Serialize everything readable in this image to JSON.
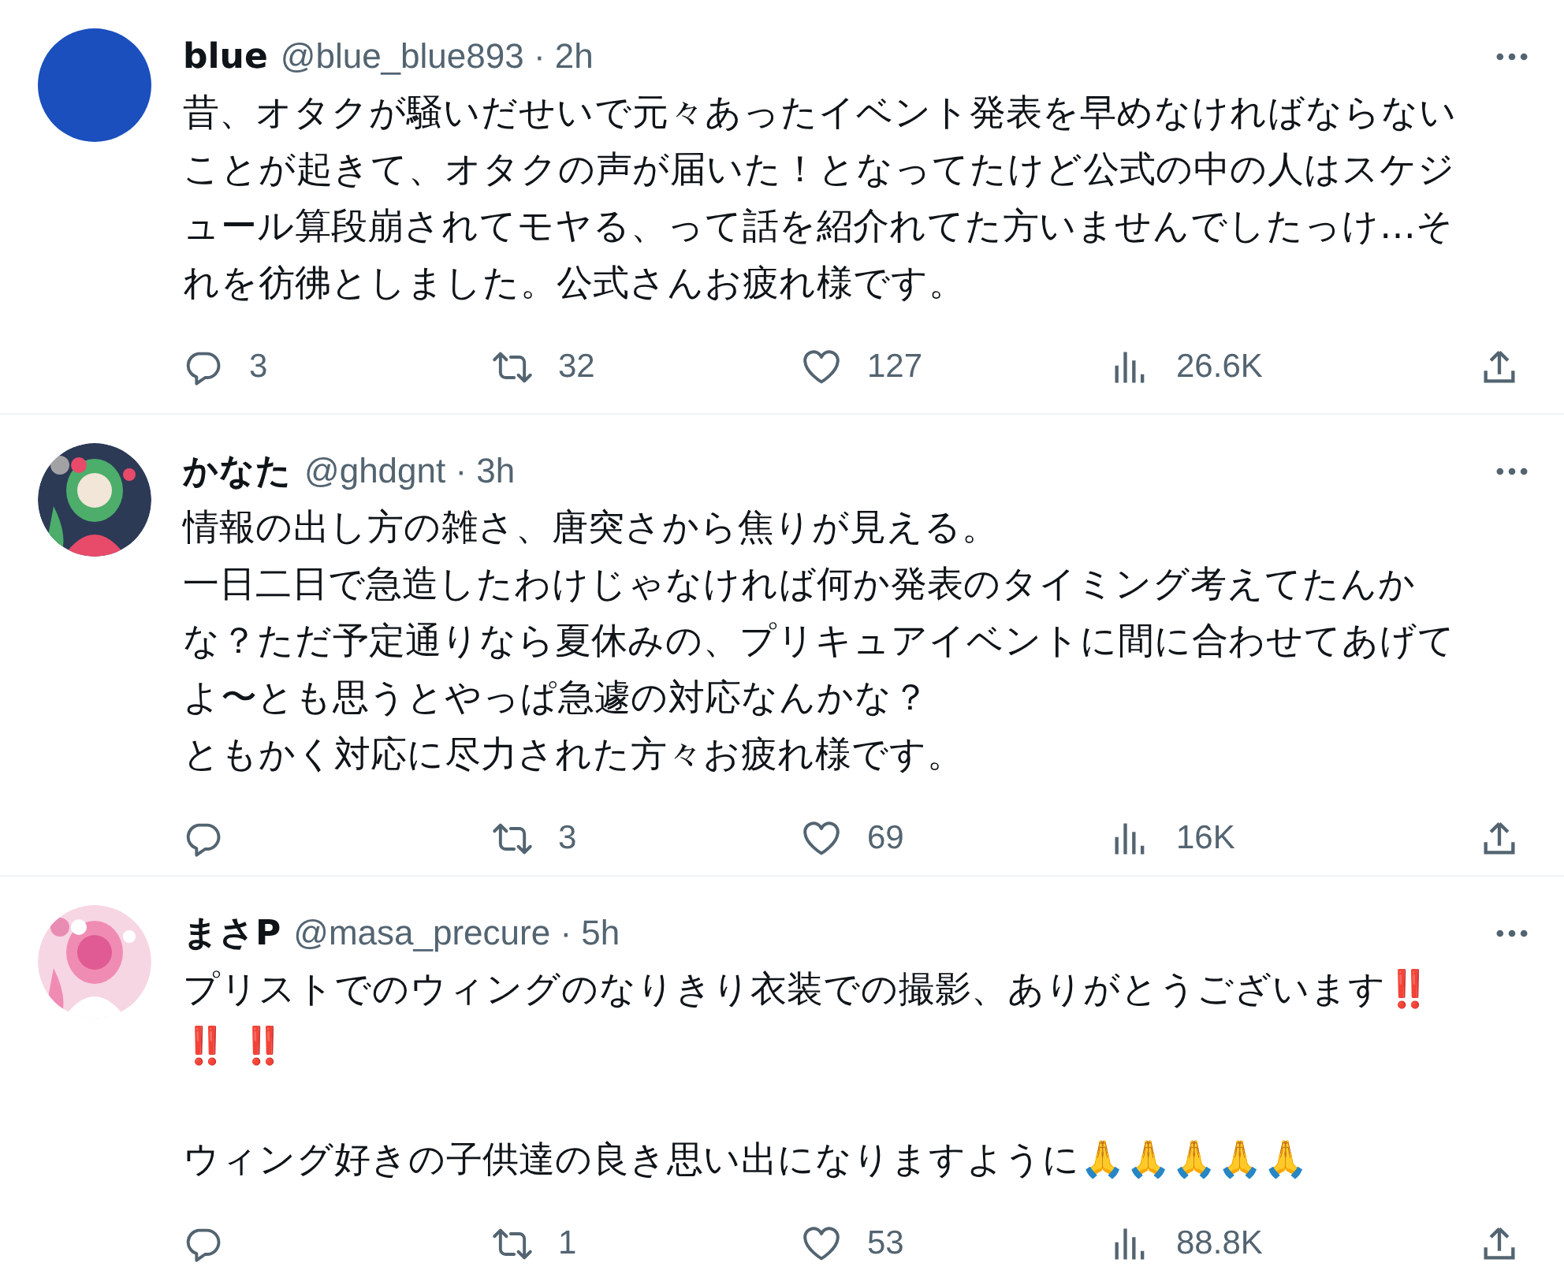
{
  "tweets": [
    {
      "avatar": {
        "kind": "plain",
        "color": "#1a4fbd"
      },
      "name": "blue",
      "meta": "@blue_blue893 · 2h",
      "paragraphs": [
        [
          "昔、オタクが騒いだせいで元々あったイベント発表を早めなければならない",
          "ことが起きて、オタクの声が届いた！となってたけど公式の中の人はスケジ",
          "ュール算段崩されてモヤる、って話を紹介れてた方いませんでしたっけ…そ",
          "れを彷彿としました。公式さんお疲れ様です。"
        ]
      ],
      "stats": {
        "replies": "3",
        "retweets": "32",
        "likes": "127",
        "views": "26.6K"
      }
    },
    {
      "avatar": {
        "kind": "picture"
      },
      "name": "かなた",
      "meta": "@ghdgnt · 3h",
      "paragraphs": [
        [
          "情報の出し方の雑さ、唐突さから焦りが見える。",
          "一日二日で急造したわけじゃなければ何か発表のタイミング考えてたんか",
          "な？ただ予定通りなら夏休みの、プリキュアイベントに間に合わせてあげて",
          "よ〜とも思うとやっぱ急遽の対応なんかな？",
          "ともかく対応に尽力された方々お疲れ様です。"
        ]
      ],
      "stats": {
        "retweets": "3",
        "likes": "69",
        "views": "16K"
      }
    },
    {
      "avatar": {
        "kind": "picture"
      },
      "name": "まさP",
      "meta": "@masa_precure · 5h",
      "paragraphs": [
        [
          "プリストでのウィングのなりきり衣装での撮影、ありがとうございます‼️",
          "‼️ ‼️"
        ],
        [
          "ウィング好きの子供達の良き思い出になりますように🙏🙏🙏🙏🙏"
        ]
      ],
      "stats": {
        "retweets": "1",
        "likes": "53",
        "views": "88.8K"
      }
    }
  ]
}
